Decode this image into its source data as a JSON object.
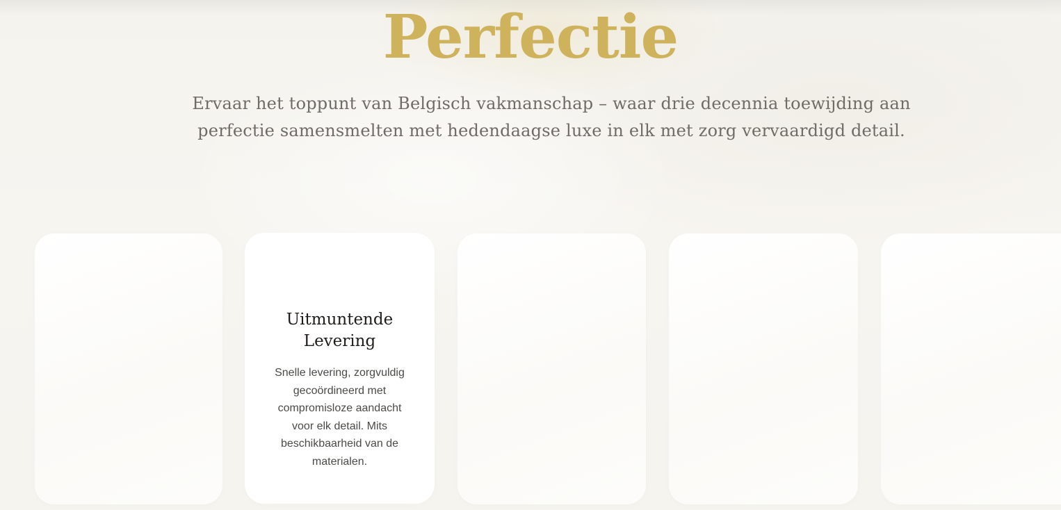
{
  "hero": {
    "title": "Perfectie",
    "subtitle": "Ervaar het toppunt van Belgisch vakmanschap – waar drie decennia toewijding aan perfectie samensmelten met hedendaagse luxe in elk met zorg vervaardigd detail."
  },
  "cards": [
    {
      "title": "",
      "description": ""
    },
    {
      "title": "Uitmuntende Levering",
      "description": "Snelle levering, zorgvuldig gecoördineerd met compromisloze aandacht voor elk detail. Mits beschikbaarheid van de materialen."
    },
    {
      "title": "",
      "description": ""
    },
    {
      "title": "",
      "description": ""
    },
    {
      "title": "",
      "description": ""
    }
  ],
  "colors": {
    "accent_gold": "#cfb25c",
    "text_muted": "#6f6b66",
    "text_dark": "#1f1c1a",
    "background": "#f6f4ef",
    "card_background": "#ffffff"
  }
}
